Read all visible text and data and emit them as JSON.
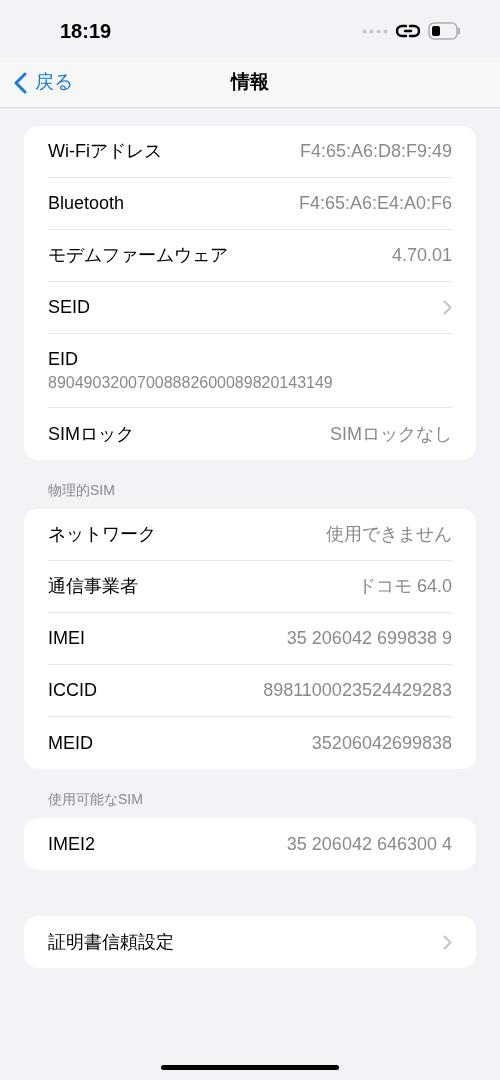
{
  "status_bar": {
    "time": "18:19"
  },
  "nav_bar": {
    "back": "戻る",
    "title": "情報"
  },
  "sections": [
    {
      "rows": [
        {
          "kind": "value",
          "label": "Wi-Fiアドレス",
          "value": "F4:65:A6:D8:F9:49"
        },
        {
          "kind": "value",
          "label": "Bluetooth",
          "value": "F4:65:A6:E4:A0:F6"
        },
        {
          "kind": "value",
          "label": "モデムファームウェア",
          "value": "4.70.01"
        },
        {
          "kind": "link",
          "label": "SEID"
        },
        {
          "kind": "stacked",
          "label": "EID",
          "value": "89049032007008882600089820143149"
        },
        {
          "kind": "value",
          "label": "SIMロック",
          "value": "SIMロックなし"
        }
      ]
    },
    {
      "header": "物理的SIM",
      "rows": [
        {
          "kind": "value",
          "label": "ネットワーク",
          "value": "使用できません"
        },
        {
          "kind": "value",
          "label": "通信事業者",
          "value": "ドコモ 64.0"
        },
        {
          "kind": "value",
          "label": "IMEI",
          "value": "35 206042 699838 9"
        },
        {
          "kind": "value",
          "label": "ICCID",
          "value": "8981100023524429283"
        },
        {
          "kind": "value",
          "label": "MEID",
          "value": "35206042699838"
        }
      ]
    },
    {
      "header": "使用可能なSIM",
      "rows": [
        {
          "kind": "value",
          "label": "IMEI2",
          "value": "35 206042 646300 4"
        }
      ]
    },
    {
      "rows": [
        {
          "kind": "link",
          "label": "証明書信頼設定"
        }
      ]
    }
  ]
}
